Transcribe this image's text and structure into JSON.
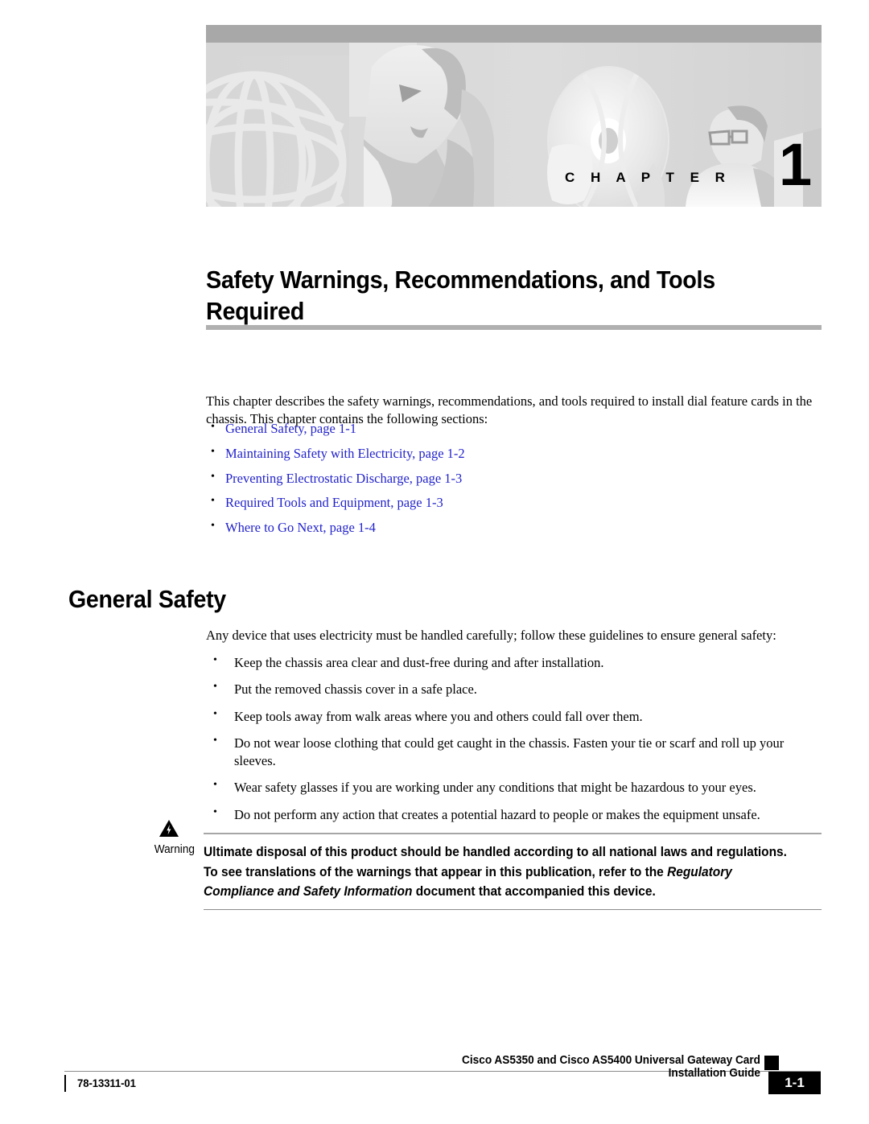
{
  "banner": {
    "chapter_word": "C H A P T E R",
    "chapter_number": "1"
  },
  "chapter": {
    "title": "Safety Warnings, Recommendations, and Tools Required",
    "intro": "This chapter describes the safety warnings, recommendations, and tools required to install dial feature cards in the chassis. This chapter contains the following sections:",
    "bullet_glyph": "•",
    "link_color": "#2323cc",
    "sections": [
      {
        "label": "General Safety, page 1-1"
      },
      {
        "label": "Maintaining Safety with Electricity, page 1-2"
      },
      {
        "label": "Preventing Electrostatic Discharge, page 1-3"
      },
      {
        "label": "Required Tools and Equipment, page 1-3"
      },
      {
        "label": "Where to Go Next, page 1-4"
      }
    ]
  },
  "general_safety": {
    "heading": "General Safety",
    "intro": "Any device that uses electricity must be handled carefully; follow these guidelines to ensure general safety:",
    "guidelines": [
      "Keep the chassis area clear and dust-free during and after installation.",
      "Put the removed chassis cover in a safe place.",
      "Keep tools away from walk areas where you and others could fall over them.",
      "Do not wear loose clothing that could get caught in the chassis. Fasten your tie or scarf and roll up your sleeves.",
      "Wear safety glasses if you are working under any conditions that might be hazardous to your eyes.",
      "Do not perform any action that creates a potential hazard to people or makes the equipment unsafe."
    ]
  },
  "warning": {
    "icon": "warning-triangle-lightning-icon",
    "label": "Warning",
    "text_before": "Ultimate disposal of this product should be handled according to all national laws and regulations. To see translations of the warnings that appear in this publication, refer to the ",
    "text_italic": "Regulatory Compliance and Safety Information",
    "text_after": " document that accompanied this device."
  },
  "footer": {
    "doc_number": "78-13311-01",
    "guide_title": "Cisco AS5350 and Cisco AS5400 Universal Gateway Card Installation Guide",
    "page_number": "1-1"
  }
}
